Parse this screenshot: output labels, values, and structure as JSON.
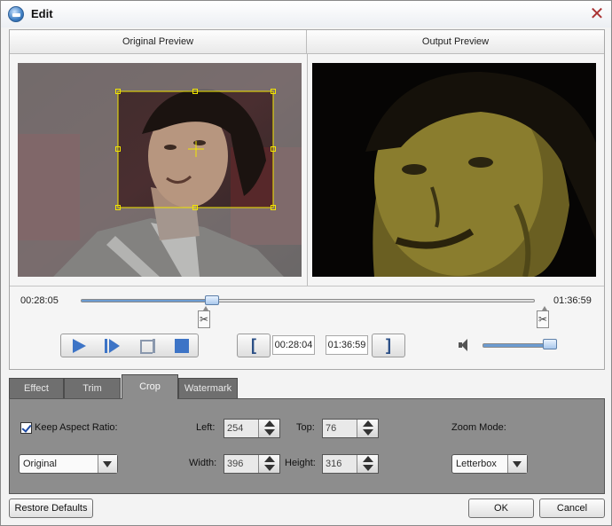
{
  "window": {
    "title": "Edit"
  },
  "preview": {
    "original_label": "Original Preview",
    "output_label": "Output Preview"
  },
  "timeline": {
    "current_time": "00:28:05",
    "total_time": "01:36:59",
    "position_fraction": 0.29
  },
  "trim": {
    "start": "00:28:04",
    "end": "01:36:59",
    "start_bracket": "[",
    "end_bracket": "]"
  },
  "volume": {
    "level_fraction": 0.9
  },
  "tabs": [
    {
      "label": "Effect"
    },
    {
      "label": "Trim"
    },
    {
      "label": "Crop",
      "active": true
    },
    {
      "label": "Watermark"
    }
  ],
  "crop": {
    "keep_aspect_label": "Keep Aspect Ratio:",
    "keep_aspect_checked": true,
    "aspect_value": "Original",
    "left_label": "Left:",
    "left_value": "254",
    "top_label": "Top:",
    "top_value": "76",
    "width_label": "Width:",
    "width_value": "396",
    "height_label": "Height:",
    "height_value": "316",
    "zoom_label": "Zoom Mode:",
    "zoom_value": "Letterbox"
  },
  "footer": {
    "restore_label": "Restore Defaults",
    "ok_label": "OK",
    "cancel_label": "Cancel"
  },
  "colors": {
    "accent": "#3d74c6",
    "crop_box": "#f2e600",
    "tab_panel": "#8d8d8d"
  }
}
